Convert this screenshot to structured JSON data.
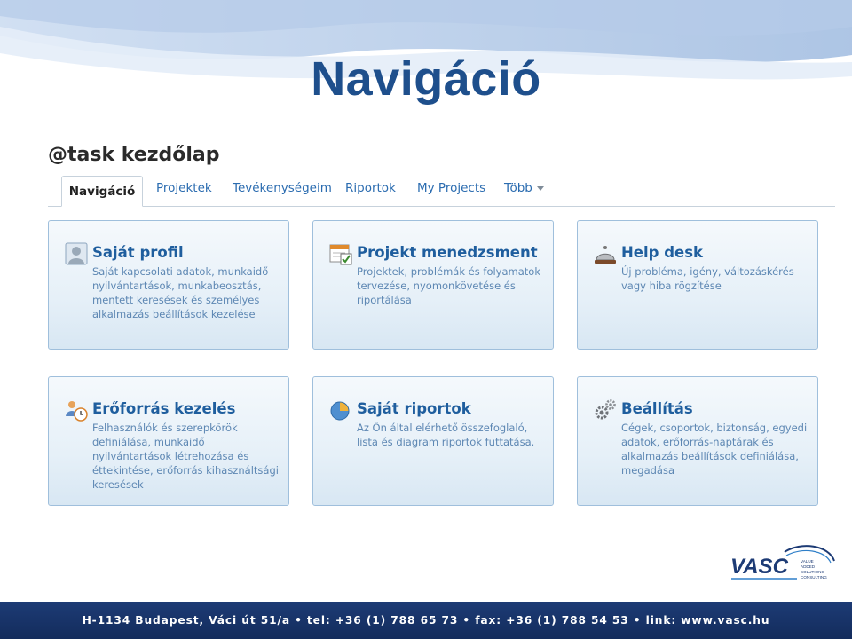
{
  "slide": {
    "title": "Navigáció"
  },
  "app": {
    "title": "@task kezdőlap"
  },
  "tabs": [
    {
      "label": "Navigáció",
      "active": true
    },
    {
      "label": "Projektek"
    },
    {
      "label": "Tevékenységeim"
    },
    {
      "label": "Riportok"
    },
    {
      "label": "My Projects"
    },
    {
      "label": "Több"
    }
  ],
  "cards": [
    {
      "title": "Saját profil",
      "icon": "profile-icon",
      "desc": "Saját kapcsolati adatok, munkaidő nyilvántartások, munkabeosztás, mentett keresések és személyes alkalmazás beállítások kezelése"
    },
    {
      "title": "Projekt menedzsment",
      "icon": "project-calendar-icon",
      "desc": "Projektek, problémák és folyamatok tervezése, nyomonkövetése és riportálása"
    },
    {
      "title": "Help desk",
      "icon": "service-bell-icon",
      "desc": "Új probléma, igény, változáskérés vagy hiba rögzítése"
    },
    {
      "title": "Erőforrás kezelés",
      "icon": "resource-users-clock-icon",
      "desc": "Felhasználók és szerepkörök definiálása, munkaidő nyilvántartások létrehozása és éttekintése, erőforrás kihasználtsági keresések"
    },
    {
      "title": "Saját riportok",
      "icon": "pie-chart-icon",
      "desc": "Az Ön által elérhető összefoglaló, lista és diagram riportok futtatása."
    },
    {
      "title": "Beállítás",
      "icon": "gears-icon",
      "desc": "Cégek, csoportok, biztonság, egyedi adatok, erőforrás-naptárak és alkalmazás beállítások definiálása, megadása"
    }
  ],
  "logo": {
    "name": "VASC",
    "tagline": [
      "VALUE",
      "ADDED",
      "SOLUTIONS",
      "CONSULTING"
    ]
  },
  "footer": {
    "text": "H-1134 Budapest, Váci út 51/a • tel: +36 (1) 788 65 73 • fax: +36 (1) 788 54 53 • link: www.vasc.hu"
  },
  "colors": {
    "title_blue": "#1e4f8c",
    "link_blue": "#2b6cb0",
    "card_border": "#9fbfdc",
    "footer_bg": "#1d3b75"
  }
}
